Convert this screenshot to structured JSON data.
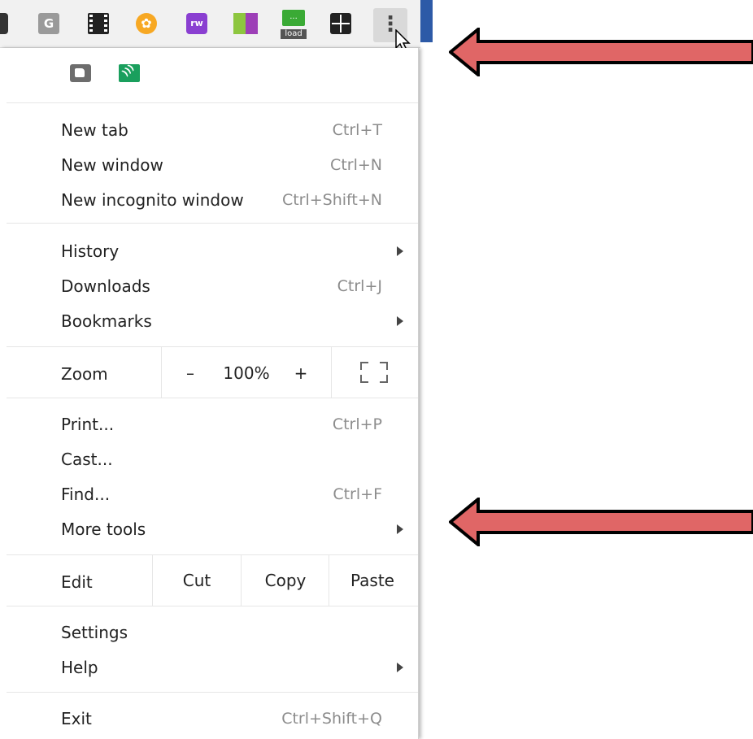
{
  "toolbar": {
    "extensions": [
      "dark-extension-icon",
      "g-extension-icon",
      "film-extension-icon",
      "star-extension-icon",
      "puzzle-rw-extension-icon",
      "color-bars-extension-icon",
      "load-extension-icon",
      "grid-extension-icon"
    ],
    "g_label": "G",
    "star_glyph": "✿",
    "rw_label": "rw",
    "load_top": "...",
    "load_label": "load",
    "menu_button_glyph": "⋮"
  },
  "menu": {
    "group1": [
      {
        "label": "New tab",
        "shortcut": "Ctrl+T"
      },
      {
        "label": "New window",
        "shortcut": "Ctrl+N"
      },
      {
        "label": "New incognito window",
        "shortcut": "Ctrl+Shift+N"
      }
    ],
    "group2": [
      {
        "label": "History",
        "submenu": true
      },
      {
        "label": "Downloads",
        "shortcut": "Ctrl+J"
      },
      {
        "label": "Bookmarks",
        "submenu": true
      }
    ],
    "zoom": {
      "label": "Zoom",
      "minus": "–",
      "value": "100%",
      "plus": "+"
    },
    "group3": [
      {
        "label": "Print...",
        "shortcut": "Ctrl+P"
      },
      {
        "label": "Cast..."
      },
      {
        "label": "Find...",
        "shortcut": "Ctrl+F"
      },
      {
        "label": "More tools",
        "submenu": true
      }
    ],
    "edit": {
      "label": "Edit",
      "cut": "Cut",
      "copy": "Copy",
      "paste": "Paste"
    },
    "group4": [
      {
        "label": "Settings"
      },
      {
        "label": "Help",
        "submenu": true
      }
    ],
    "exit": {
      "label": "Exit",
      "shortcut": "Ctrl+Shift+Q"
    }
  },
  "annotations": {
    "arrow_color": "#e06666",
    "arrow_outline": "#000000"
  }
}
